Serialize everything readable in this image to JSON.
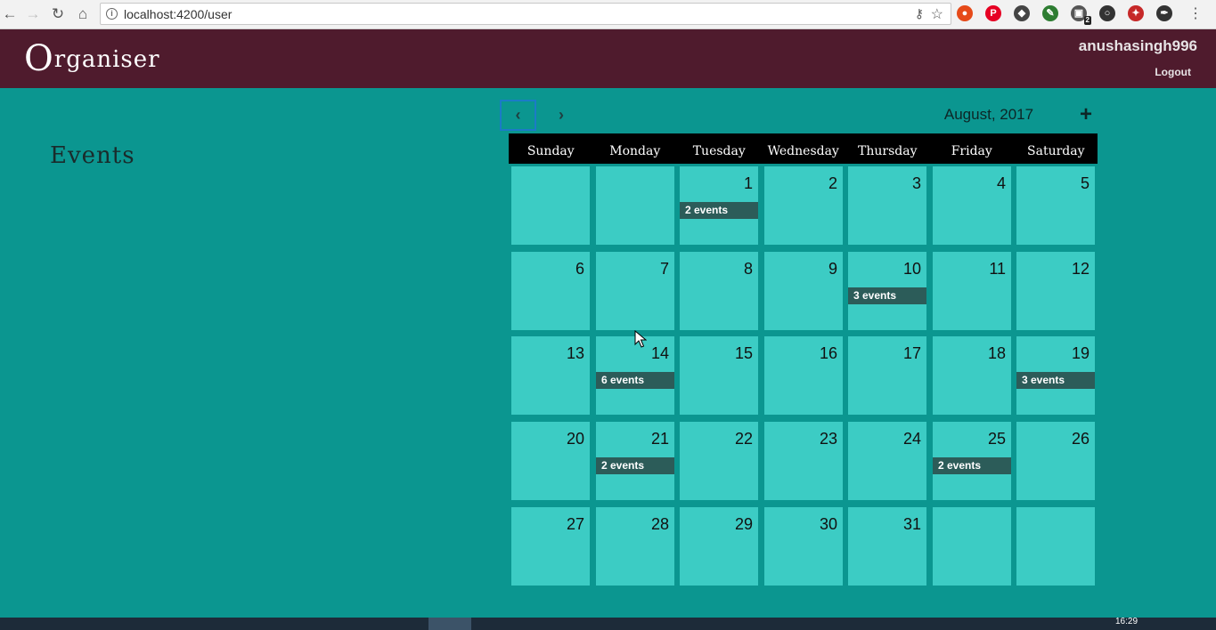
{
  "browser": {
    "url": "localhost:4200/user",
    "extensions": [
      {
        "icon": "adblock-icon",
        "color": "#e64a19"
      },
      {
        "icon": "pinterest-icon",
        "color": "#e60023"
      },
      {
        "icon": "shield-icon",
        "color": "#444444"
      },
      {
        "icon": "feather-icon",
        "color": "#2e7d32"
      },
      {
        "icon": "puzzle-badge-icon",
        "color": "#555555",
        "badge": "2"
      },
      {
        "icon": "circle-icon",
        "color": "#333333"
      },
      {
        "icon": "rocket-icon",
        "color": "#c62828"
      },
      {
        "icon": "pen-icon",
        "color": "#333333"
      }
    ]
  },
  "header": {
    "brand_initial": "O",
    "brand_rest": "rganiser",
    "username": "anushasingh996",
    "logout_label": "Logout"
  },
  "events_section": {
    "title": "Events"
  },
  "calendar": {
    "month_label": "August, 2017",
    "prev_icon": "chevron-left-icon",
    "next_icon": "chevron-right-icon",
    "add_icon": "plus-icon",
    "weekdays": [
      "Sunday",
      "Monday",
      "Tuesday",
      "Wednesday",
      "Thursday",
      "Friday",
      "Saturday"
    ],
    "weeks": [
      [
        {
          "day": ""
        },
        {
          "day": ""
        },
        {
          "day": "1",
          "events": "2 events"
        },
        {
          "day": "2"
        },
        {
          "day": "3"
        },
        {
          "day": "4"
        },
        {
          "day": "5"
        }
      ],
      [
        {
          "day": "6"
        },
        {
          "day": "7"
        },
        {
          "day": "8"
        },
        {
          "day": "9"
        },
        {
          "day": "10",
          "events": "3 events"
        },
        {
          "day": "11"
        },
        {
          "day": "12"
        }
      ],
      [
        {
          "day": "13"
        },
        {
          "day": "14",
          "events": "6 events"
        },
        {
          "day": "15"
        },
        {
          "day": "16"
        },
        {
          "day": "17"
        },
        {
          "day": "18"
        },
        {
          "day": "19",
          "events": "3 events"
        }
      ],
      [
        {
          "day": "20"
        },
        {
          "day": "21",
          "events": "2 events"
        },
        {
          "day": "22"
        },
        {
          "day": "23"
        },
        {
          "day": "24"
        },
        {
          "day": "25",
          "events": "2 events"
        },
        {
          "day": "26"
        }
      ],
      [
        {
          "day": "27"
        },
        {
          "day": "28"
        },
        {
          "day": "29"
        },
        {
          "day": "30"
        },
        {
          "day": "31"
        },
        {
          "day": ""
        },
        {
          "day": ""
        }
      ]
    ]
  },
  "taskbar": {
    "clock": "16:29"
  },
  "colors": {
    "page_bg": "#0b9690",
    "header_bg": "#4f1b2d",
    "cell_bg": "#3cccc4",
    "event_bar": "#2c5c59",
    "weekday_bar": "#000000"
  }
}
